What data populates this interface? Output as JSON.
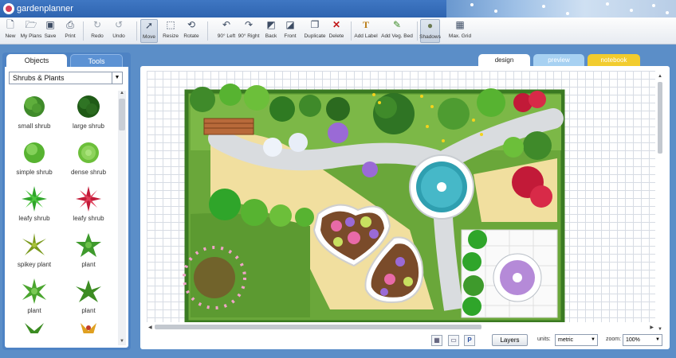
{
  "header": {
    "logo_text": "gardenplanner"
  },
  "toolbar": {
    "new": "New",
    "my_plans": "My Plans",
    "save": "Save",
    "print": "Print",
    "redo": "Redo",
    "undo": "Undo",
    "move": "Move",
    "resize": "Resize",
    "rotate": "Rotate",
    "rotate_left": "90° Left",
    "rotate_right": "90° Right",
    "back": "Back",
    "front": "Front",
    "duplicate": "Duplicate",
    "delete": "Delete",
    "add_label": "Add Label",
    "add_veg_bed": "Add Veg. Bed",
    "shadows": "Shadows",
    "max_grid": "Max. Grid"
  },
  "left_panel": {
    "tabs": {
      "objects": "Objects",
      "tools": "Tools"
    },
    "category": "Shrubs & Plants",
    "objects": [
      {
        "label": "small shrub",
        "icon": "small-shrub-icon",
        "color": "#3f8a2a"
      },
      {
        "label": "large shrub",
        "icon": "large-shrub-icon",
        "color": "#1f5a16"
      },
      {
        "label": "simple shrub",
        "icon": "simple-shrub-icon",
        "color": "#57b331"
      },
      {
        "label": "dense shrub",
        "icon": "dense-shrub-icon",
        "color": "#6cbf3a"
      },
      {
        "label": "leafy shrub",
        "icon": "leafy-shrub-icon",
        "color": "#2fa52a"
      },
      {
        "label": "leafy shrub",
        "icon": "leafy-shrub-red-icon",
        "color": "#c21a38"
      },
      {
        "label": "spikey plant",
        "icon": "spikey-plant-icon",
        "color": "#7a9a1c"
      },
      {
        "label": "plant",
        "icon": "plant-icon",
        "color": "#3e9a2c"
      },
      {
        "label": "plant",
        "icon": "plant-star-icon",
        "color": "#4aa52e"
      },
      {
        "label": "plant",
        "icon": "plant-fern-icon",
        "color": "#3c8c22"
      }
    ]
  },
  "view_tabs": {
    "design": "design",
    "preview": "preview",
    "notebook": "notebook"
  },
  "status_bar": {
    "layers": "Layers",
    "units_label": "units:",
    "units_value": "metric",
    "zoom_label": "zoom:",
    "zoom_value": "100%",
    "plan_view_letter": "P"
  }
}
